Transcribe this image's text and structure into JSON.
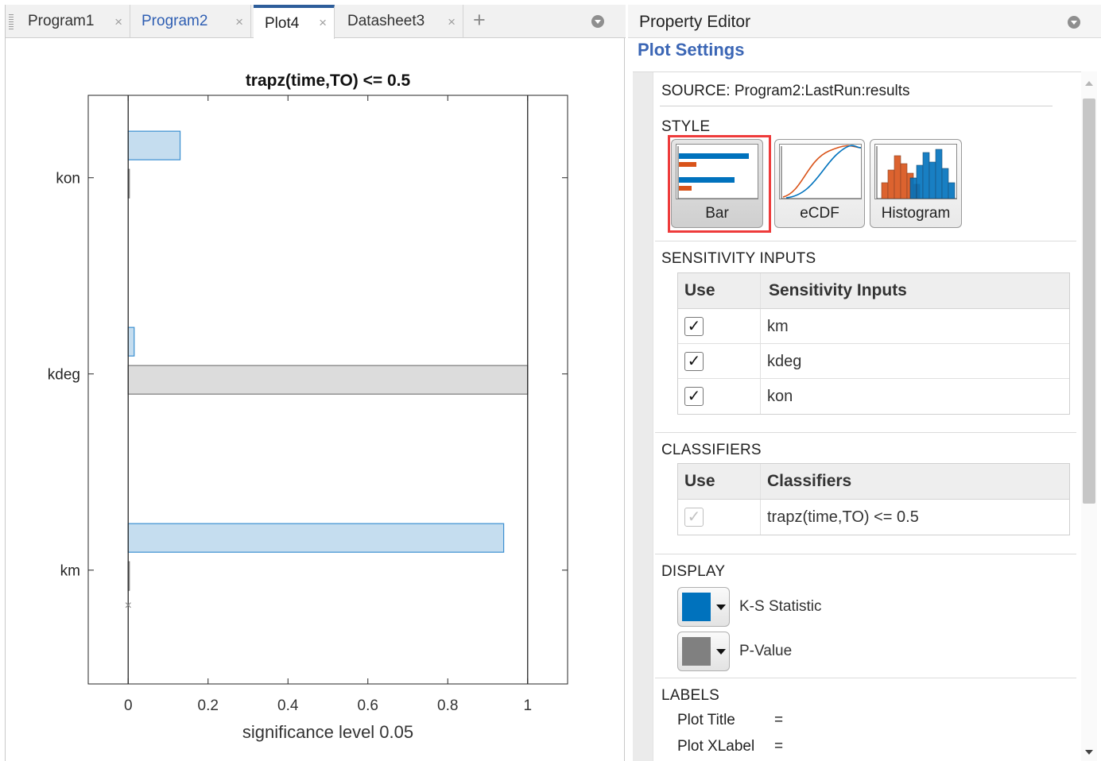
{
  "tabs": [
    {
      "label": "Program1",
      "style": "normal"
    },
    {
      "label": "Program2",
      "style": "link"
    },
    {
      "label": "Plot4",
      "style": "active"
    },
    {
      "label": "Datasheet3",
      "style": "normal"
    }
  ],
  "tab_close_glyph": "×",
  "tab_add_glyph": "+",
  "plot": {
    "title": "trapz(time,TO) <= 0.5",
    "xlabel": "significance level 0.05"
  },
  "chart_data": {
    "type": "bar",
    "orientation": "horizontal",
    "title": "trapz(time,TO) <= 0.5",
    "xlabel": "significance level 0.05",
    "ylabel": "",
    "xlim": [
      -0.1,
      1.1
    ],
    "xticks": [
      "0",
      "0.2",
      "0.4",
      "0.6",
      "0.8",
      "1"
    ],
    "categories": [
      "km",
      "kdeg",
      "kon"
    ],
    "series": [
      {
        "values": [
          0.94,
          0.015,
          0.13
        ],
        "color": "#c5ddef",
        "edge": "#3b8fd1"
      },
      {
        "values": [
          0.0,
          1.0,
          0.002
        ],
        "color": "#dcdcdc",
        "edge": "#7a7a7a"
      }
    ],
    "marker": {
      "category": "km",
      "x": 0,
      "glyph": "×"
    },
    "reference_lines": [
      0,
      1
    ]
  },
  "property_editor": {
    "title": "Property Editor",
    "subtitle": "Plot Settings",
    "source": "SOURCE:  Program2:LastRun:results",
    "style_section": "STYLE",
    "styles": [
      {
        "label": "Bar",
        "selected": true
      },
      {
        "label": "eCDF",
        "selected": false
      },
      {
        "label": "Histogram",
        "selected": false
      }
    ],
    "sensitivity_section": "SENSITIVITY INPUTS",
    "sensitivity_table": {
      "headers": [
        "Use",
        "Sensitivity Inputs"
      ],
      "rows": [
        {
          "checked": "✓",
          "name": "km"
        },
        {
          "checked": "✓",
          "name": "kdeg"
        },
        {
          "checked": "✓",
          "name": "kon"
        }
      ]
    },
    "classifiers_section": "CLASSIFIERS",
    "classifiers_table": {
      "headers": [
        "Use",
        "Classifiers"
      ],
      "rows": [
        {
          "checked": "✓",
          "name": "trapz(time,TO) <= 0.5",
          "disabled": true
        }
      ]
    },
    "display_section": "DISPLAY",
    "display": [
      {
        "label": "K-S Statistic",
        "color": "#0072bd"
      },
      {
        "label": "P-Value",
        "color": "#808080"
      }
    ],
    "labels_section": "LABELS",
    "labels": [
      {
        "name": "Plot Title",
        "eq": "="
      },
      {
        "name": "Plot XLabel",
        "eq": "="
      }
    ]
  }
}
